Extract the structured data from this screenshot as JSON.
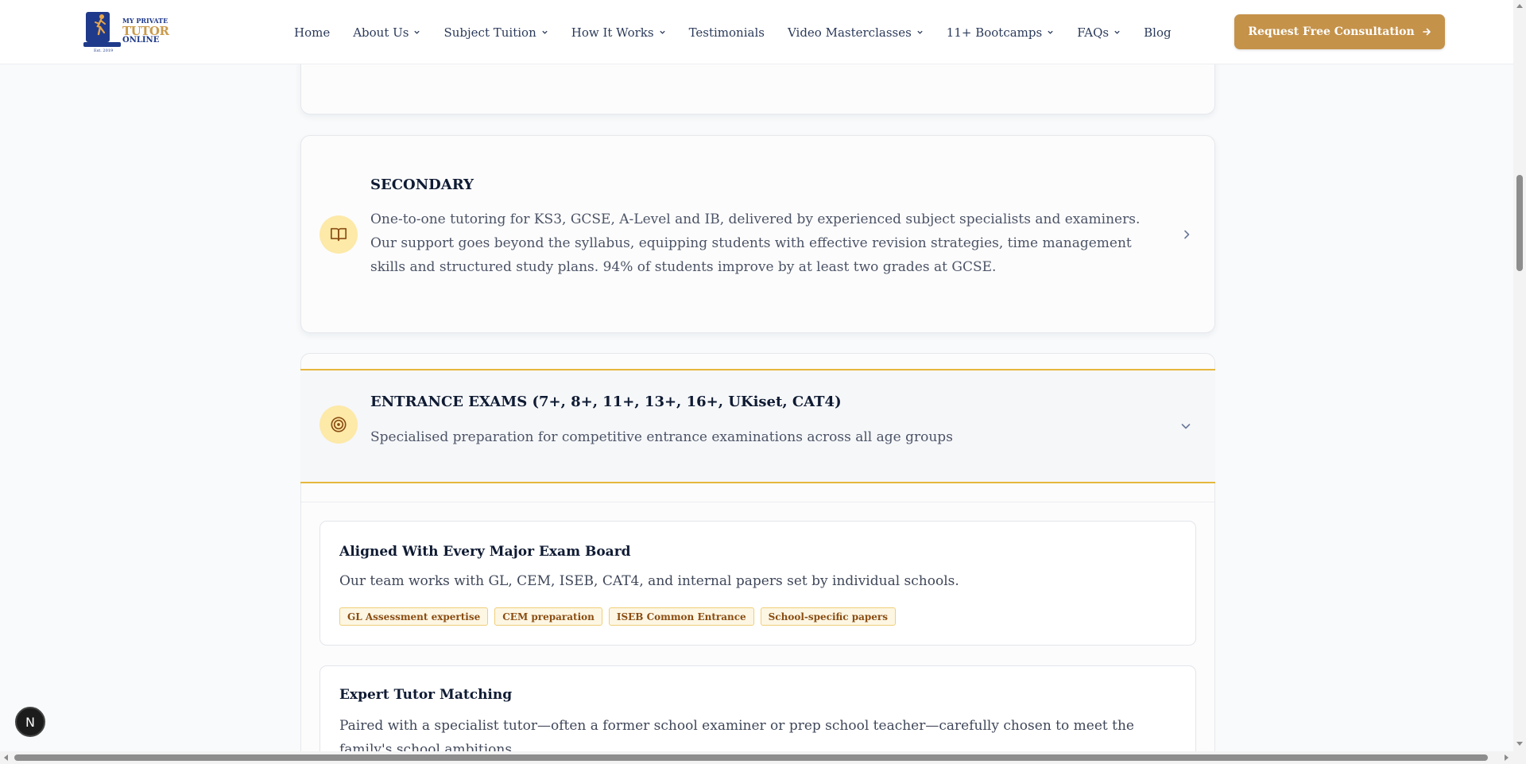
{
  "logo": {
    "line1": "MY PRIVATE",
    "line2": "TUTOR",
    "line3": "ONLINE",
    "line4": "Est. 2019"
  },
  "nav": {
    "items": [
      {
        "label": "Home",
        "dropdown": false
      },
      {
        "label": "About Us",
        "dropdown": true
      },
      {
        "label": "Subject Tuition",
        "dropdown": true
      },
      {
        "label": "How It Works",
        "dropdown": true
      },
      {
        "label": "Testimonials",
        "dropdown": false
      },
      {
        "label": "Video Masterclasses",
        "dropdown": true
      },
      {
        "label": "11+ Bootcamps",
        "dropdown": true
      },
      {
        "label": "FAQs",
        "dropdown": true
      },
      {
        "label": "Blog",
        "dropdown": false
      }
    ],
    "cta_label": "Request Free Consultation"
  },
  "secondary": {
    "title": "SECONDARY",
    "description": "One-to-one tutoring for KS3, GCSE, A-Level and IB, delivered by experienced subject specialists and examiners. Our support goes beyond the syllabus, equipping students with effective revision strategies, time management skills and structured study plans. 94% of students improve by at least two grades at GCSE.",
    "icon": "book-open-icon"
  },
  "entrance": {
    "title": "ENTRANCE EXAMS (7+, 8+, 11+, 13+, 16+, UKiset, CAT4)",
    "description": "Specialised preparation for competitive entrance examinations across all age groups",
    "icon": "target-icon",
    "features": [
      {
        "title": "Aligned With Every Major Exam Board",
        "description": "Our team works with GL, CEM, ISEB, CAT4, and internal papers set by individual schools.",
        "tags": [
          "GL Assessment expertise",
          "CEM preparation",
          "ISEB Common Entrance",
          "School-specific papers"
        ]
      },
      {
        "title": "Expert Tutor Matching",
        "description": "Paired with a specialist tutor—often a former school examiner or prep school teacher—carefully chosen to meet the family's school ambitions."
      }
    ]
  },
  "badge": {
    "label": "N"
  },
  "colors": {
    "accent_gold": "#c5924a",
    "highlight_yellow": "#e6b73c",
    "icon_bg": "#fde9a8",
    "navy": "#1f3a8a"
  }
}
